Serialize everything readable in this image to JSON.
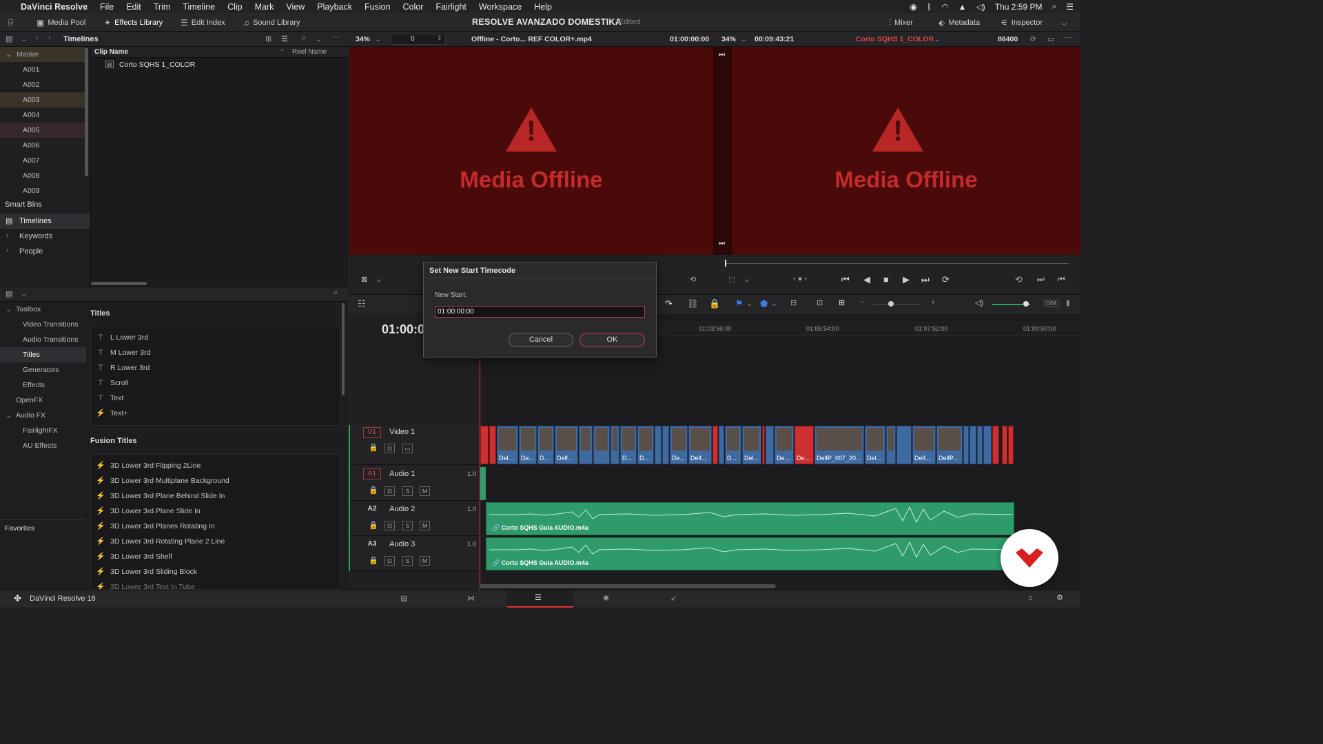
{
  "menubar": {
    "app": "DaVinci Resolve",
    "items": [
      "File",
      "Edit",
      "Trim",
      "Timeline",
      "Clip",
      "Mark",
      "View",
      "Playback",
      "Fusion",
      "Color",
      "Fairlight",
      "Workspace",
      "Help"
    ],
    "clock": "Thu 2:59 PM"
  },
  "toolbar": {
    "media_pool": "Media Pool",
    "effects_library": "Effects Library",
    "edit_index": "Edit Index",
    "sound_library": "Sound Library",
    "project_title": "RESOLVE AVANZADO DOMESTIKA",
    "project_state": "Edited",
    "mixer": "Mixer",
    "metadata": "Metadata",
    "inspector": "Inspector"
  },
  "bin": {
    "header": "Timelines",
    "master": "Master",
    "bins": [
      "A001",
      "A002",
      "A003",
      "A004",
      "A005",
      "A006",
      "A007",
      "A008",
      "A009"
    ],
    "col_clip_name": "Clip Name",
    "col_reel_name": "Reel Name",
    "clip": "Corto SQHS 1_COLOR",
    "smart_bins_title": "Smart Bins",
    "smart_bins": [
      "Timelines",
      "Keywords",
      "People"
    ]
  },
  "effects": {
    "tree": [
      {
        "label": "Toolbox"
      },
      {
        "label": "Video Transitions"
      },
      {
        "label": "Audio Transitions"
      },
      {
        "label": "Titles"
      },
      {
        "label": "Generators"
      },
      {
        "label": "Effects"
      },
      {
        "label": "OpenFX"
      },
      {
        "label": "Audio FX"
      },
      {
        "label": "FairlightFX"
      },
      {
        "label": "AU Effects"
      }
    ],
    "favorites": "Favorites",
    "titles_header": "Titles",
    "titles": [
      "L Lower 3rd",
      "M Lower 3rd",
      "R Lower 3rd",
      "Scroll",
      "Text",
      "Text+"
    ],
    "fusion_header": "Fusion Titles",
    "fusion_titles": [
      "3D Lower 3rd Flipping 2Line",
      "3D Lower 3rd Multiplane Background",
      "3D Lower 3rd Plane Behind Slide In",
      "3D Lower 3rd Plane Slide In",
      "3D Lower 3rd Planes Rotating In",
      "3D Lower 3rd Rotating Plane 2 Line",
      "3D Lower 3rd Shelf",
      "3D Lower 3rd Sliding Block",
      "3D Lower 3rd Text In Tube"
    ]
  },
  "viewer": {
    "src_zoom": "34%",
    "src_frame": "0",
    "src_clip": "Offline - Corto... REF COLOR+.mp4",
    "src_tc": "01:00:00:00",
    "rec_zoom": "34%",
    "rec_duration": "00:09:43:21",
    "rec_timeline": "Corto SQHS 1_COLOR",
    "rec_frames": "86400",
    "offline_text": "Media Offline"
  },
  "timeline": {
    "current_tc": "01:00:00",
    "ruler": [
      "01:03:56:00",
      "01:05:54:00",
      "01:07:52:00",
      "01:09:50:00"
    ],
    "tracks": [
      {
        "id": "V1",
        "name": "Video 1"
      },
      {
        "id": "A1",
        "name": "Audio 1",
        "vol": "1.0"
      },
      {
        "id": "A2",
        "name": "Audio 2",
        "vol": "1.0"
      },
      {
        "id": "A3",
        "name": "Audio 3",
        "vol": "1.0"
      }
    ],
    "solo": "S",
    "mute": "M",
    "dim": "DIM",
    "audio_clip": "Corto SQHS Guia AUDIO.m4a",
    "video_clip_labels": [
      "Del...",
      "De...",
      "D...",
      "Delf...",
      "D...",
      "D...",
      "De...",
      "Delf...",
      "D...",
      "Del...",
      "De...",
      "De...",
      "DelfP_007_20...",
      "Del...",
      "Delf...",
      "DelfP..."
    ]
  },
  "dialog": {
    "title": "Set New Start Timecode",
    "label": "New Start:",
    "value": "01:00:00:00",
    "cancel": "Cancel",
    "ok": "OK"
  },
  "status": {
    "app_version": "DaVinci Resolve 16"
  }
}
